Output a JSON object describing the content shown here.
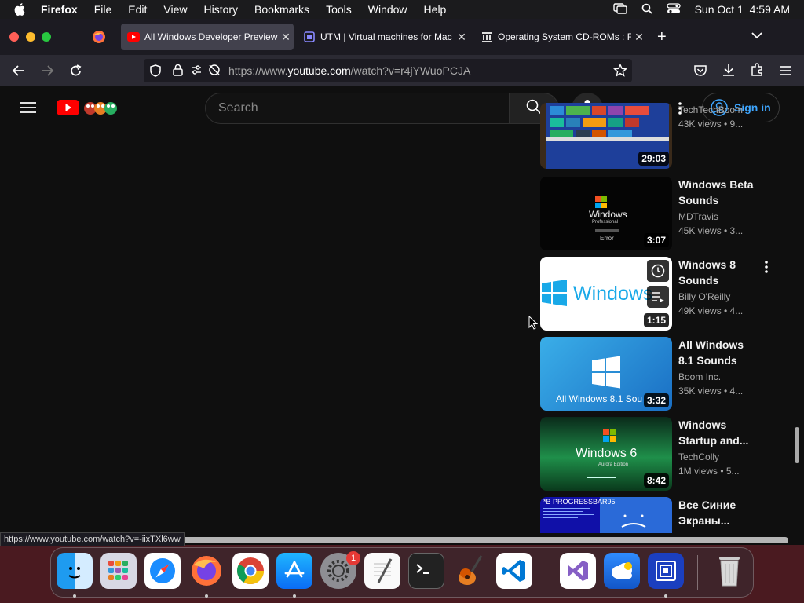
{
  "menubar": {
    "app_name": "Firefox",
    "items": [
      "File",
      "Edit",
      "View",
      "History",
      "Bookmarks",
      "Tools",
      "Window",
      "Help"
    ],
    "datetime": "Sun Oct 1  4:59 AM"
  },
  "tabs": [
    {
      "title": "All Windows Developer Preview",
      "active": true
    },
    {
      "title": "UTM | Virtual machines for Mac",
      "active": false
    },
    {
      "title": "Operating System CD-ROMs : F",
      "active": false
    }
  ],
  "address_bar": {
    "url_prefix": "https://www.",
    "url_domain": "youtube.com",
    "url_path": "/watch?v=r4jYWuoPCJA"
  },
  "youtube": {
    "search_placeholder": "Search",
    "sign_in_label": "Sign in",
    "videos": [
      {
        "title": "",
        "channel": "TechTechBoom",
        "meta": "43K views  • 9...",
        "duration": "29:03"
      },
      {
        "title": "Windows Beta Sounds",
        "channel": "MDTravis",
        "meta": "45K views  • 3...",
        "duration": "3:07"
      },
      {
        "title": "Windows 8 Sounds",
        "channel": "Billy O'Reilly",
        "meta": "49K views  • 4...",
        "duration": "1:15"
      },
      {
        "title": "All Windows 8.1 Sounds",
        "channel": "Boom Inc.",
        "meta": "35K views  • 4...",
        "duration": "3:32"
      },
      {
        "title": "Windows Startup and...",
        "channel": "TechColly",
        "meta": "1M views  • 5...",
        "duration": "8:42"
      },
      {
        "title": "Все Синие Экраны...",
        "channel": "",
        "meta": "",
        "duration": ""
      }
    ],
    "thumb_text": {
      "winxp_brand": "Windows",
      "winxp_edition": "Professional",
      "winxp_error": "Error",
      "win8_logo": "Windows",
      "win81_caption": "All Windows 8.1 Sou",
      "win6_brand": "Windows 6",
      "win6_edition": "Aurora Edition",
      "bsod_text": "*B PROGRESSBAR95"
    }
  },
  "status_url": "https://www.youtube.com/watch?v=-iixTXl6ww",
  "dock": {
    "apps": [
      "finder",
      "launchpad",
      "safari",
      "firefox",
      "chrome",
      "app-store",
      "system-settings",
      "textedit",
      "terminal",
      "garageband",
      "vscode",
      "visual-studio",
      "cloud-app",
      "utm",
      "trash"
    ],
    "settings_badge": "1"
  }
}
